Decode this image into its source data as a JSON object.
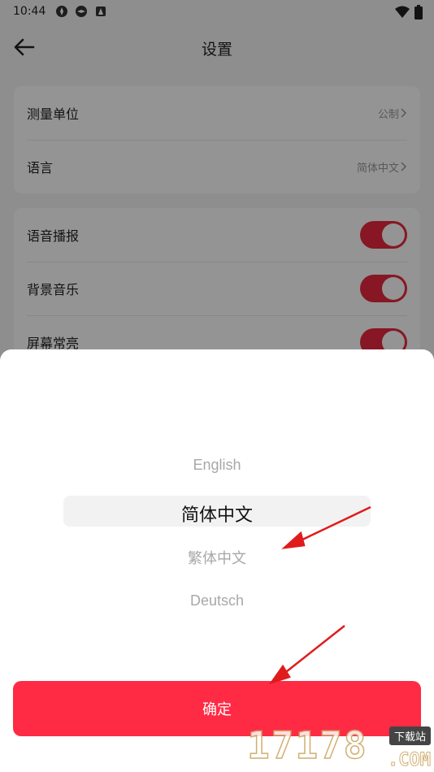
{
  "status_bar": {
    "time": "10:44",
    "icons": [
      "app-icon-1",
      "app-icon-2",
      "notification-icon"
    ],
    "right_icons": [
      "wifi-icon",
      "battery-icon"
    ]
  },
  "header": {
    "title": "设置",
    "back_icon": "arrow-left-icon"
  },
  "settings": {
    "group1": [
      {
        "label": "测量单位",
        "value": "公制"
      },
      {
        "label": "语言",
        "value": "简体中文"
      }
    ],
    "group2": [
      {
        "label": "语音播报",
        "enabled": true
      },
      {
        "label": "背景音乐",
        "enabled": true
      },
      {
        "label": "屏幕常亮",
        "enabled": true
      }
    ]
  },
  "language_picker": {
    "options": [
      "English",
      "简体中文",
      "繁体中文",
      "Deutsch"
    ],
    "selected_index": 1,
    "confirm_label": "确定"
  },
  "watermark": {
    "digits": "17178",
    "badge": "下载站",
    "suffix": ".COM"
  },
  "colors": {
    "accent": "#ff2a44",
    "toggle": "#e8293f",
    "arrow": "#e01b1b"
  }
}
